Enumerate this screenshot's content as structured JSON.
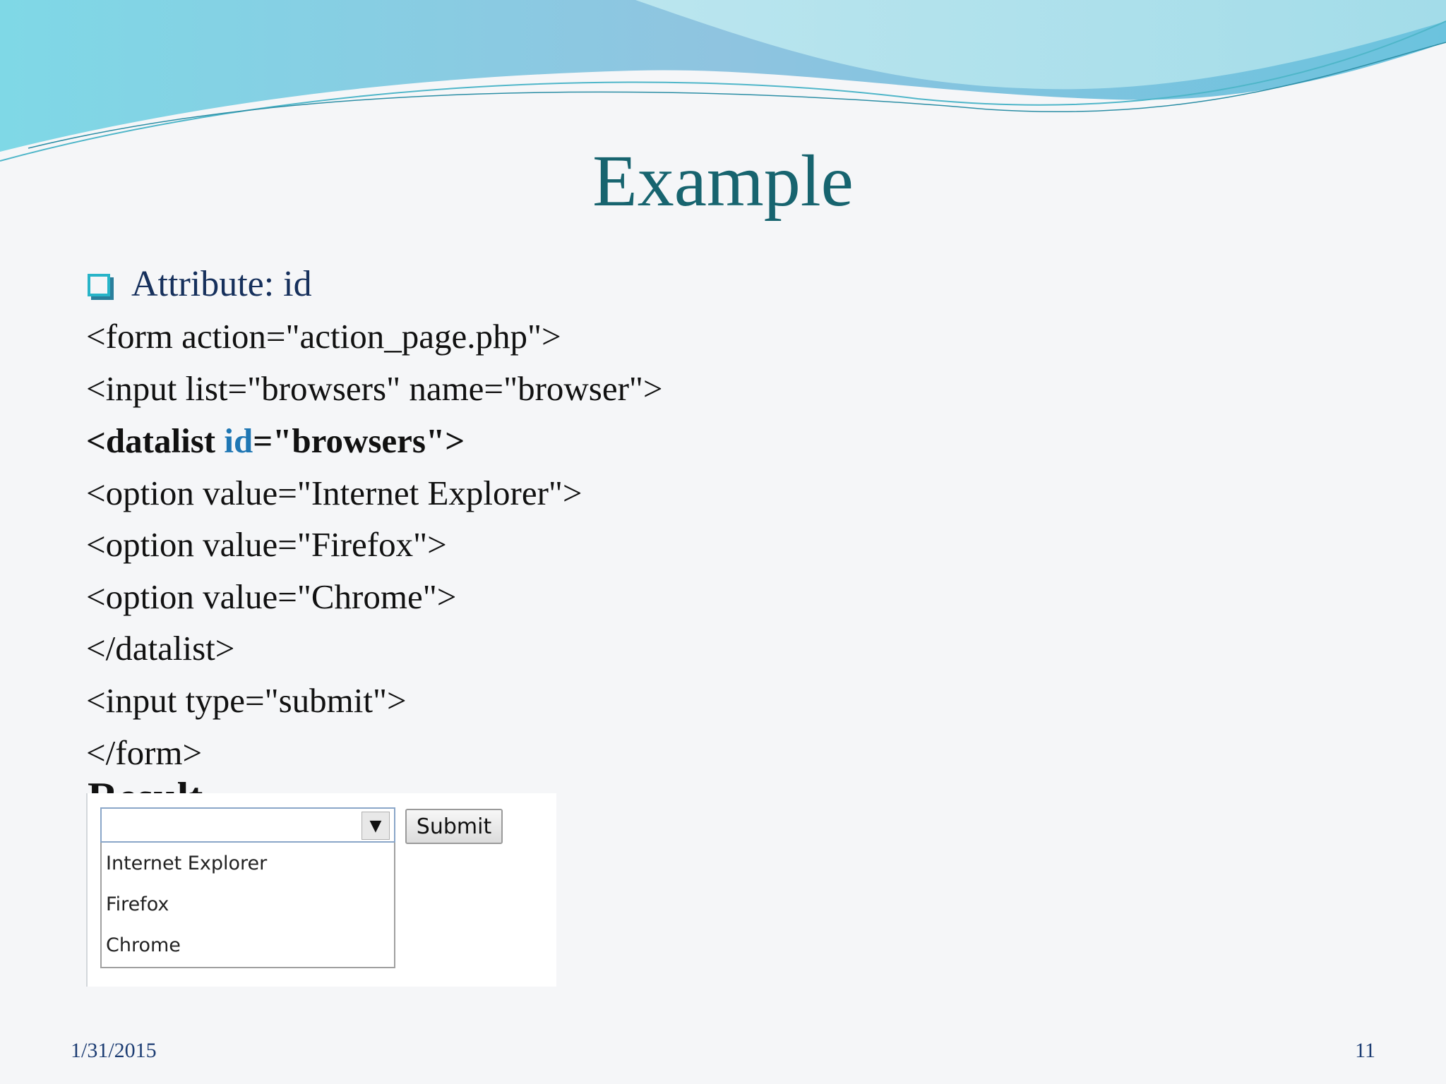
{
  "slide": {
    "title": "Example",
    "bullet": "Attribute: id",
    "code_lines": [
      "<form action=\"action_page.php\">",
      "<input list=\"browsers\" name=\"browser\">",
      "<option value=\"Internet Explorer\">",
      "<option value=\"Firefox\">",
      "<option value=\"Chrome\">",
      "</datalist>",
      "<input type=\"submit\">",
      "</form>"
    ],
    "highlight_line": {
      "before": "<datalist ",
      "id_word": "id",
      "after": "=\"browsers\">"
    },
    "partial_heading": "Result",
    "footer_date": "1/31/2015",
    "page_number": "11"
  },
  "result_demo": {
    "input_value": "",
    "dropdown_icon": "▼",
    "submit_label": "Submit",
    "options": [
      "Internet Explorer",
      "Firefox",
      "Chrome"
    ]
  },
  "colors": {
    "title": "#17646f",
    "bullet_text": "#16305c",
    "id_highlight": "#1f77b4",
    "footer": "#1d3d73"
  }
}
